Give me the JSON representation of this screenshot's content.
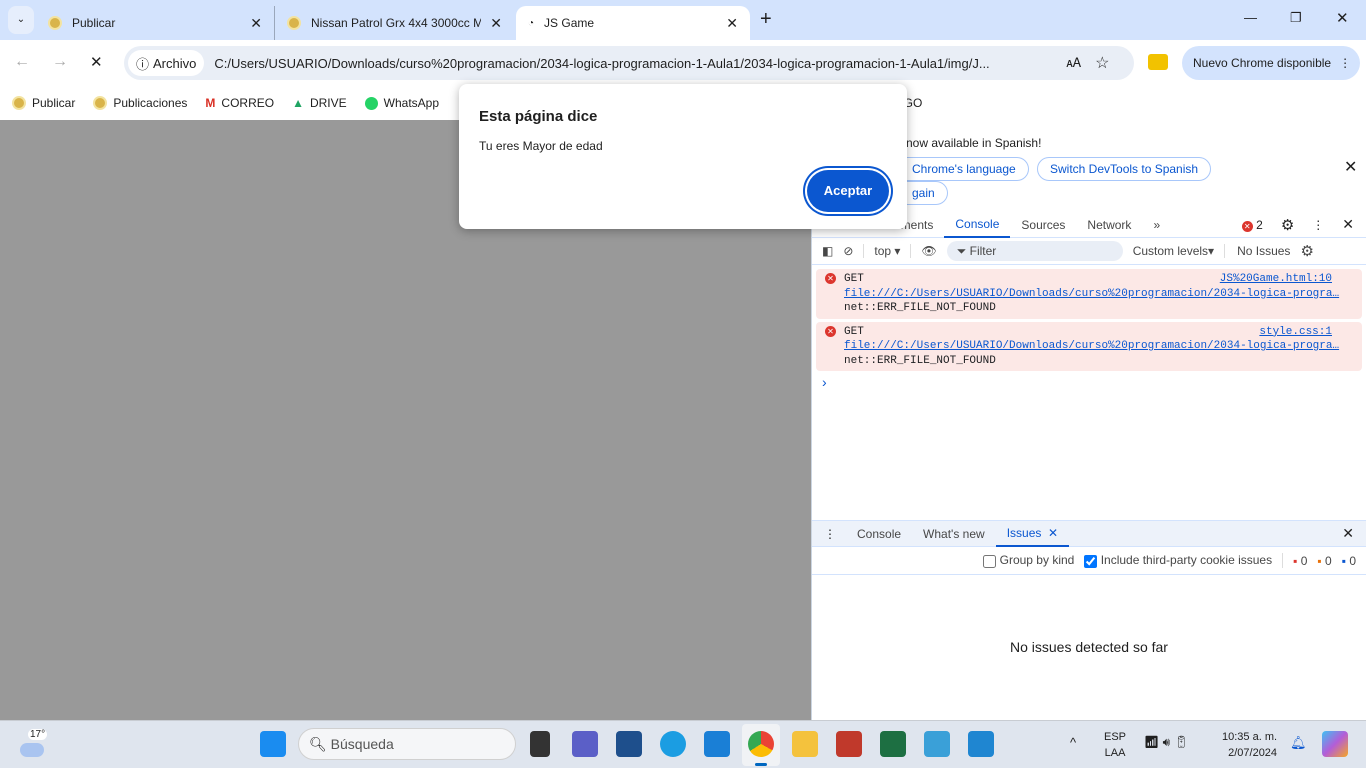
{
  "tabs": [
    {
      "label": "Publicar"
    },
    {
      "label": "Nissan Patrol Grx 4x4 3000cc M"
    },
    {
      "label": "JS Game",
      "active": true
    }
  ],
  "toolbar": {
    "chip": "Archivo",
    "url": "C:/Users/USUARIO/Downloads/curso%20programacion/2034-logica-programacion-1-Aula1/2034-logica-programacion-1-Aula1/img/J...",
    "update": "Nuevo Chrome disponible"
  },
  "bookmarks": [
    "Publicar",
    "Publicaciones",
    "CORREO",
    "DRIVE",
    "WhatsApp",
    "IIGO"
  ],
  "dialog": {
    "title": "Esta página dice",
    "message": "Tu eres Mayor de edad",
    "button": "Aceptar"
  },
  "devtools": {
    "banner": {
      "text": "now available in Spanish!",
      "btn1": "Chrome's language",
      "btn2": "Switch DevTools to Spanish",
      "btn3": "gain"
    },
    "tabs": [
      "ements",
      "Console",
      "Sources",
      "Network"
    ],
    "error_count": "2",
    "console_toolbar": {
      "context": "top",
      "filter_placeholder": "Filter",
      "levels": "Custom levels",
      "issues": "No Issues"
    },
    "messages": [
      {
        "method": "GET",
        "source": "JS%20Game.html:10",
        "url": "file:///C:/Users/USUARIO/Downloads/curso%20programacion/2034-logica-progra…",
        "error": "net::ERR_FILE_NOT_FOUND"
      },
      {
        "method": "GET",
        "source": "style.css:1",
        "url": "file:///C:/Users/USUARIO/Downloads/curso%20programacion/2034-logica-progra…",
        "error": "net::ERR_FILE_NOT_FOUND"
      }
    ],
    "prompt": "›",
    "drawer": {
      "tabs": [
        "Console",
        "What's new",
        "Issues"
      ],
      "group_by_kind": "Group by kind",
      "third_party": "Include third-party cookie issues",
      "counts": [
        "0",
        "0",
        "0"
      ],
      "empty": "No issues detected so far"
    }
  },
  "taskbar": {
    "weather": "17°",
    "search": "Búsqueda",
    "lang1": "ESP",
    "lang2": "LAA",
    "time": "10:35 a. m.",
    "date": "2/07/2024"
  }
}
